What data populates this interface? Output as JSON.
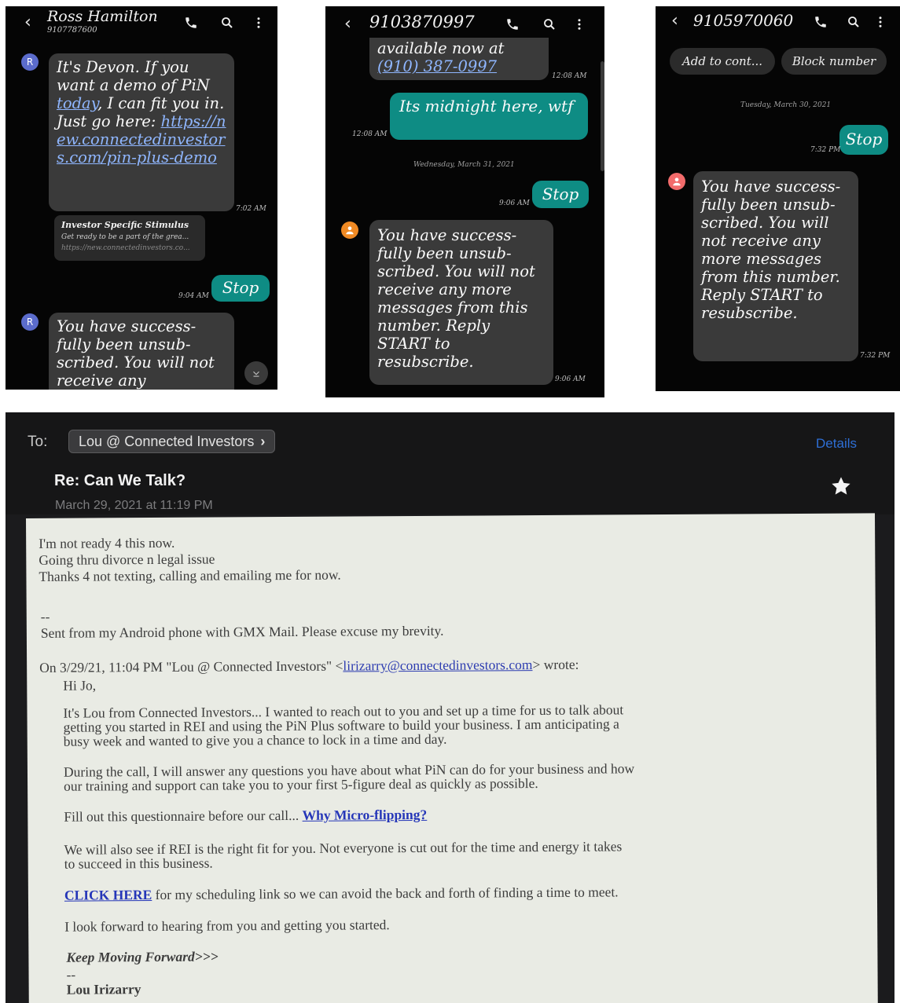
{
  "phone1": {
    "contact_name": "Ross Hamilton",
    "contact_number": "9107787600",
    "avatar_letter": "R",
    "msg1_text": "It's Devon. If you want a demo of PiN ",
    "msg1_today": "today",
    "msg1_text2": ", I can fit you in. Just go here: ",
    "msg1_link": "https://new.connectedinvestors.com/pin-plus-demo",
    "msg1_time": "7:02 AM",
    "preview_title": "Investor Specific Stimulus",
    "preview_desc": "Get ready to be a part of the grea...",
    "preview_url": "https://new.connectedinvestors.co...",
    "sent_text": "Stop",
    "sent_time": "9:04 AM",
    "reply_text": "You have success-fully been unsub-scribed. You will not receive any"
  },
  "phone2": {
    "contact_number": "9103870997",
    "top_msg_text": "available now at",
    "top_msg_link": "(910) 387-0997",
    "top_msg_time": "12:08 AM",
    "sent1_text": "Its midnight here, wtf",
    "sent1_time": "12:08 AM",
    "date_sep": "Wednesday, March 31, 2021",
    "sent2_text": "Stop",
    "sent2_time": "9:06 AM",
    "reply_text": "You have success-fully been unsub-scribed. You will not receive any more messages from this number. Reply START to resubscribe.",
    "reply_time": "9:06 AM"
  },
  "phone3": {
    "contact_number": "9105970060",
    "btn_add": "Add to cont...",
    "btn_block": "Block number",
    "date_sep": "Tuesday, March 30, 2021",
    "sent_text": "Stop",
    "sent_time": "7:32 PM",
    "reply_text": "You have success-fully been unsub-scribed. You will not receive any more messages from this number. Reply START to resubscribe.",
    "reply_time": "7:32 PM"
  },
  "email": {
    "to_label": "To:",
    "to_recipient": "Lou @ Connected Investors",
    "details_label": "Details",
    "subject": "Re: Can We Talk?",
    "date": "March 29, 2021 at 11:19 PM",
    "body_lines": [
      "I'm not ready 4 this now.",
      "Going thru divorce n legal issue",
      "Thanks 4 not texting, calling and emailing me for now.",
      "--",
      "Sent from my Android phone with GMX Mail. Please excuse my brevity."
    ],
    "quote_header_pre": "On 3/29/21, 11:04 PM \"Lou @ Connected Investors\" <",
    "quote_header_email": "lirizarry@connectedinvestors.com",
    "quote_header_post": "> wrote:",
    "greeting": "Hi Jo,",
    "para1_lines": [
      "It's Lou from Connected Investors... I wanted to reach out to you and set up a time for us to talk about",
      "getting you started in REI and using the PiN Plus software to build your business. I am anticipating a",
      "busy week and wanted to give you a chance to lock in a time and day."
    ],
    "para2_lines": [
      "During the call, I will answer any questions you have about what PiN can do for your business and how",
      "our training and support can take you to your first 5-figure deal as quickly as possible."
    ],
    "para3_text": "Fill out this questionnaire before our call... ",
    "para3_link": "Why Micro-flipping?",
    "para4_lines": [
      "We will also see if REI is the right fit for you. Not everyone is cut out for the time and energy it takes",
      "to succeed in this business."
    ],
    "para5_link": "CLICK HERE",
    "para5_text": " for my scheduling link so we can avoid the back and forth of finding a time to meet.",
    "para6_text": "I look forward to hearing from you and getting you started.",
    "signoff": "Keep Moving Forward>>>",
    "sig_sep": "--",
    "sig_name": "Lou Irizarry"
  }
}
